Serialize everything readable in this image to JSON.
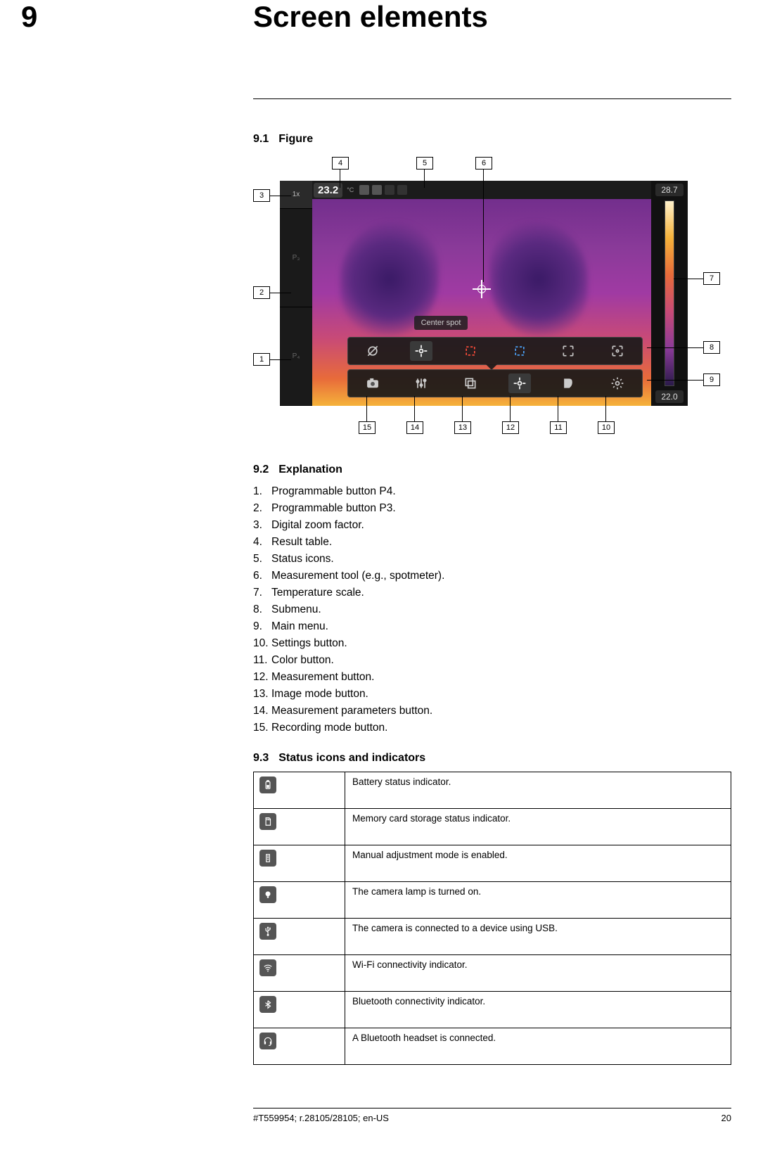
{
  "chapter": {
    "number": "9",
    "title": "Screen elements"
  },
  "sections": {
    "figure": {
      "num": "9.1",
      "title": "Figure"
    },
    "explanation": {
      "num": "9.2",
      "title": "Explanation"
    },
    "status": {
      "num": "9.3",
      "title": "Status icons and indicators"
    }
  },
  "device": {
    "zoom_label": "1x",
    "p_buttons": [
      "P₃",
      "P₄"
    ],
    "result_value": "23.2",
    "unit": "°C",
    "spot_label": "Center spot",
    "scale_top": "28.7",
    "scale_bottom": "22.0"
  },
  "callouts": [
    "1",
    "2",
    "3",
    "4",
    "5",
    "6",
    "7",
    "8",
    "9",
    "10",
    "11",
    "12",
    "13",
    "14",
    "15"
  ],
  "explanation_items": [
    "Programmable button P4.",
    "Programmable button P3.",
    "Digital zoom factor.",
    "Result table.",
    "Status icons.",
    "Measurement tool (e.g., spotmeter).",
    "Temperature scale.",
    "Submenu.",
    "Main menu.",
    "Settings button.",
    "Color button.",
    "Measurement button.",
    "Image mode button.",
    "Measurement parameters button.",
    "Recording mode button."
  ],
  "status_rows": [
    {
      "icon": "battery",
      "desc": "Battery status indicator."
    },
    {
      "icon": "sdcard",
      "desc": "Memory card storage status indicator."
    },
    {
      "icon": "manual",
      "desc": "Manual adjustment mode is enabled."
    },
    {
      "icon": "lamp",
      "desc": "The camera lamp is turned on."
    },
    {
      "icon": "usb",
      "desc": "The camera is connected to a device using USB."
    },
    {
      "icon": "wifi",
      "desc": "Wi-Fi connectivity indicator."
    },
    {
      "icon": "bluetooth",
      "desc": "Bluetooth connectivity indicator."
    },
    {
      "icon": "headset",
      "desc": "A Bluetooth headset is connected."
    }
  ],
  "footer": {
    "left": "#T559954; r.28105/28105; en-US",
    "right": "20"
  }
}
